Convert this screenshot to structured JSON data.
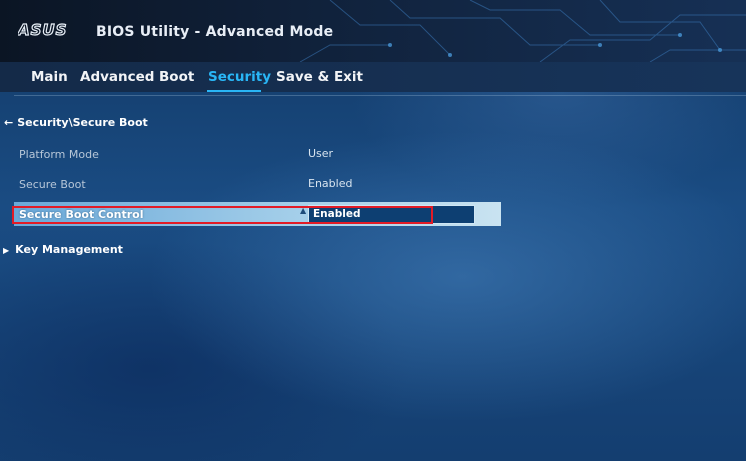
{
  "header": {
    "brand": "ASUS",
    "title": "BIOS Utility - Advanced Mode"
  },
  "tabs": [
    {
      "label": "Main",
      "active": false
    },
    {
      "label": "Advanced",
      "active": false
    },
    {
      "label": "Boot",
      "active": false
    },
    {
      "label": "Security",
      "active": true
    },
    {
      "label": "Save & Exit",
      "active": false
    }
  ],
  "breadcrumb": "Security\\Secure Boot",
  "items": {
    "platform_mode": {
      "label": "Platform Mode",
      "value": "User"
    },
    "secure_boot": {
      "label": "Secure Boot",
      "value": "Enabled"
    },
    "secure_boot_control": {
      "label": "Secure Boot Control",
      "value": "Enabled"
    },
    "key_management": {
      "label": "Key Management"
    }
  },
  "colors": {
    "accent": "#29b6f6",
    "highlight_border": "#e21b26",
    "selected_row": "#a6d0ea",
    "background": "#1a4c83"
  },
  "icons": [
    "back-arrow-icon",
    "submenu-arrow-icon",
    "dropdown-caret-icon"
  ]
}
